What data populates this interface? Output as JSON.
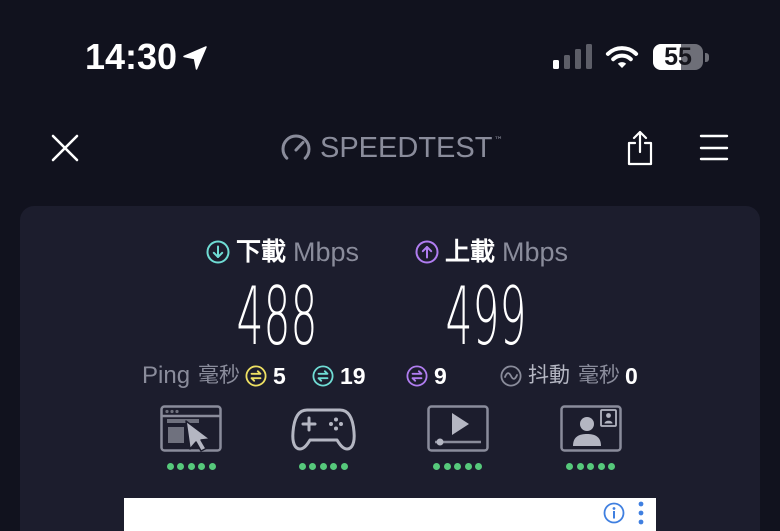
{
  "status_bar": {
    "time": "14:30",
    "battery_percent": "55",
    "signal_bars": 1,
    "signal_max": 4,
    "icons": {
      "location": "location-arrow-icon",
      "signal": "cellular-signal-icon",
      "wifi": "wifi-icon",
      "battery": "battery-icon"
    }
  },
  "header": {
    "logo_text": "SPEEDTEST",
    "trademark": "™",
    "icons": {
      "close": "close-icon",
      "logo": "speedometer-icon",
      "share": "share-icon",
      "menu": "hamburger-menu-icon"
    }
  },
  "results": {
    "download": {
      "icon": "download-arrow-icon",
      "label": "下載",
      "unit": "Mbps",
      "value": "488"
    },
    "upload": {
      "icon": "upload-arrow-icon",
      "label": "上載",
      "unit": "Mbps",
      "value": "499"
    },
    "ping": {
      "label": "Ping",
      "unit": "毫秒",
      "idle_latency": "5",
      "download_latency": "19",
      "upload_latency": "9",
      "icons": [
        "idle-latency-icon",
        "download-latency-icon",
        "upload-latency-icon"
      ]
    },
    "jitter": {
      "icon": "jitter-wave-icon",
      "label": "抖動",
      "unit": "毫秒",
      "value": "0"
    }
  },
  "quality": [
    {
      "icon": "web-browsing-icon",
      "rating": 5,
      "max": 5
    },
    {
      "icon": "gaming-controller-icon",
      "rating": 5,
      "max": 5
    },
    {
      "icon": "video-streaming-icon",
      "rating": 5,
      "max": 5
    },
    {
      "icon": "video-call-icon",
      "rating": 5,
      "max": 5
    }
  ],
  "ad_banner": {
    "icons": {
      "info": "info-icon",
      "more": "more-vertical-icon"
    }
  },
  "colors": {
    "background": "#11121e",
    "card": "#1c1d2d",
    "text": "#ffffff",
    "muted": "#8a8c9b",
    "secondary": "#b4b6c2",
    "download": "#6fdcd4",
    "upload": "#b07df0",
    "idle_ping": "#eee063",
    "rating": "#56c97b",
    "ad_accent": "#3f7fe0"
  }
}
